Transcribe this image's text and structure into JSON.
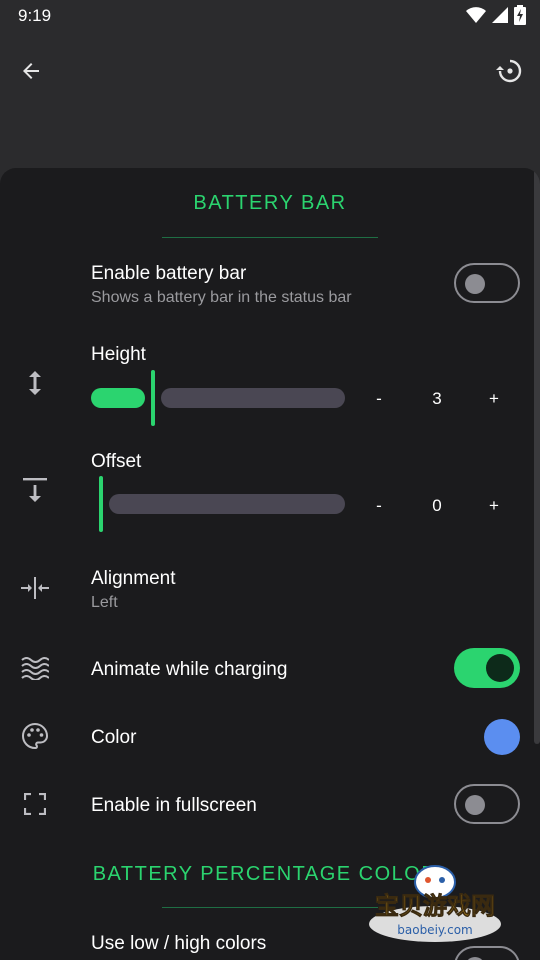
{
  "status_bar": {
    "time": "9:19"
  },
  "sections": [
    {
      "title": "BATTERY BAR"
    },
    {
      "title": "BATTERY PERCENTAGE COLOR"
    }
  ],
  "rows": {
    "enable_bar": {
      "title": "Enable battery bar",
      "subtitle": "Shows a battery bar in the status bar",
      "enabled": false
    },
    "height": {
      "title": "Height",
      "value": "3",
      "minus": "-",
      "plus": "+",
      "fraction": 0.23
    },
    "offset": {
      "title": "Offset",
      "value": "0",
      "minus": "-",
      "plus": "+",
      "fraction": 0.0
    },
    "alignment": {
      "title": "Alignment",
      "subtitle": "Left"
    },
    "animate": {
      "title": "Animate while charging",
      "enabled": true
    },
    "color": {
      "title": "Color",
      "swatch": "#5b8ef0"
    },
    "fullscreen": {
      "title": "Enable in fullscreen",
      "enabled": false
    },
    "low_high": {
      "title": "Use low / high colors"
    }
  },
  "watermark": {
    "brand": "宝贝游戏网",
    "url": "baobeiy.com"
  },
  "colors": {
    "accent": "#2bd46f",
    "sheet": "#1b1b1d",
    "background": "#2b2b2d"
  },
  "icons": {
    "back": "arrow-back-icon",
    "reset": "restore-icon",
    "height": "vertical-arrows-icon",
    "offset": "align-bottom-icon",
    "alignment": "horizontal-compress-icon",
    "animate": "waves-icon",
    "color": "palette-icon",
    "fullscreen": "fullscreen-icon"
  }
}
